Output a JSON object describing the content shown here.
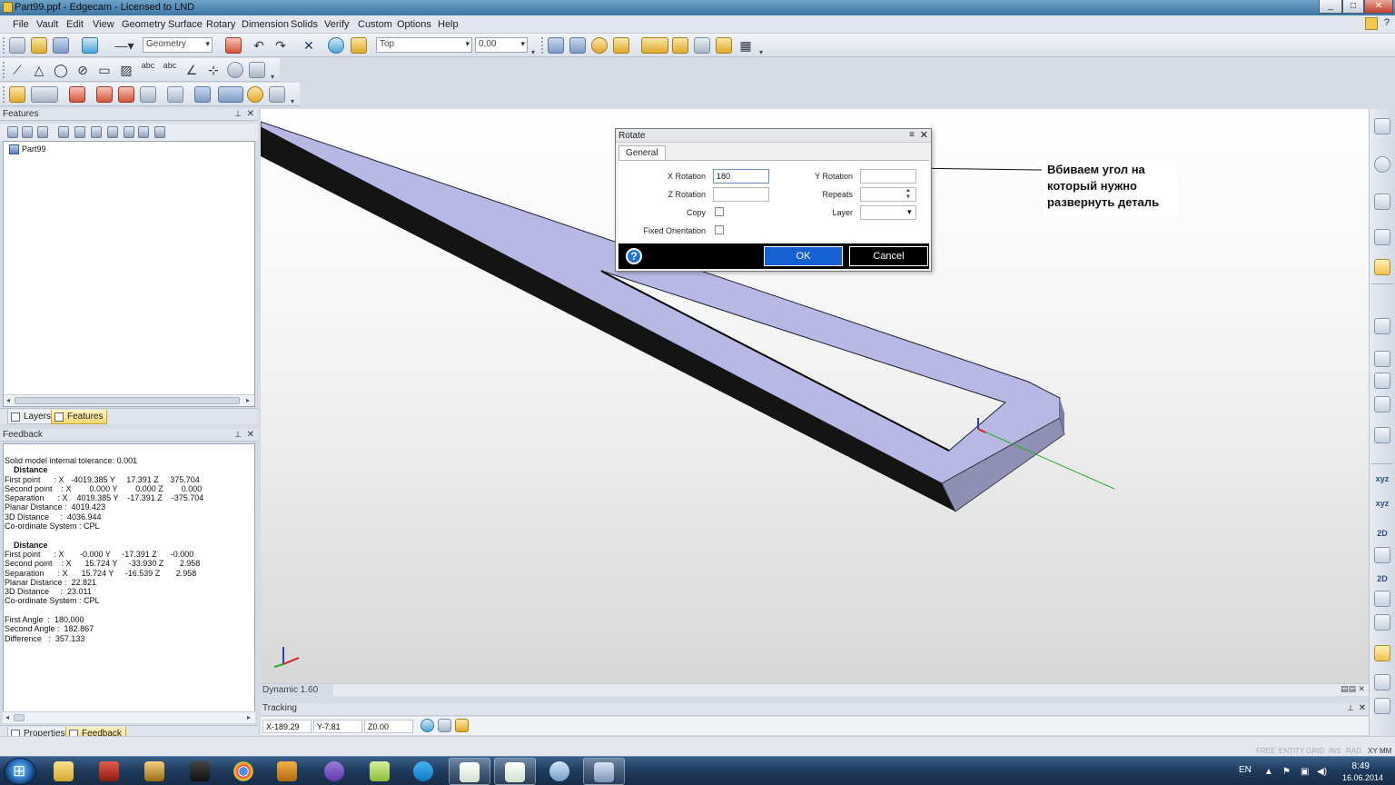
{
  "window": {
    "title": "Part99.ppf - Edgecam - Licensed to LND",
    "controls": [
      "_",
      "□",
      "✕"
    ]
  },
  "menu": {
    "items": [
      "File",
      "Vault",
      "Edit",
      "View",
      "Geometry",
      "Surface",
      "Rotary",
      "Dimension",
      "Solids",
      "Verify",
      "Custom",
      "Options",
      "Help"
    ]
  },
  "toolbar": {
    "mode_combo": "Geometry",
    "view_combo": "Top",
    "depth_combo": "0,00"
  },
  "features_panel": {
    "title": "Features",
    "tree_item": "Part99",
    "tabs": [
      "Layers",
      "Features"
    ],
    "active_tab": "Features"
  },
  "feedback_panel": {
    "title": "Feedback",
    "lines": [
      {
        "text": "Solid model internal tolerance: 0.001",
        "bold": false
      },
      {
        "text": "    Distance",
        "bold": true
      },
      {
        "text": "First point      : X   -4019.385 Y     17.391 Z     375.704",
        "bold": false
      },
      {
        "text": "Second point    : X        0.000 Y        0.000 Z        0.000",
        "bold": false
      },
      {
        "text": "Separation      : X    4019.385 Y    -17.391 Z    -375.704",
        "bold": false
      },
      {
        "text": "Planar Distance :  4019.423",
        "bold": false
      },
      {
        "text": "3D Distance     :  4036.944",
        "bold": false
      },
      {
        "text": "Co-ordinate System : CPL",
        "bold": false
      },
      {
        "text": "",
        "bold": false
      },
      {
        "text": "    Distance",
        "bold": true
      },
      {
        "text": "First point      : X       -0.000 Y     -17.391 Z      -0.000",
        "bold": false
      },
      {
        "text": "Second point    : X      15.724 Y     -33.930 Z       2.958",
        "bold": false
      },
      {
        "text": "Separation      : X      15.724 Y     -16.539 Z       2.958",
        "bold": false
      },
      {
        "text": "Planar Distance :  22.821",
        "bold": false
      },
      {
        "text": "3D Distance     :  23.011",
        "bold": false
      },
      {
        "text": "Co-ordinate System : CPL",
        "bold": false
      },
      {
        "text": "",
        "bold": false
      },
      {
        "text": "First Angle  :  180.000",
        "bold": false
      },
      {
        "text": "Second Angle :  182.867",
        "bold": false
      },
      {
        "text": "Difference   :  357.133",
        "bold": false
      }
    ],
    "tabs": [
      "Properties",
      "Feedback"
    ],
    "active_tab": "Feedback"
  },
  "viewport": {
    "dynamic_label": "Dynamic 1.60",
    "part_color": "#b7b8e3",
    "side_color": "#1a1a1a"
  },
  "tracking": {
    "title": "Tracking",
    "x": "X-189.29",
    "y": "Y-7.81",
    "z": "Z0.00"
  },
  "statusbar": {
    "flags": [
      "FREE",
      "ENTITY",
      "GRID",
      "INS",
      "RAD",
      "XY",
      "MM"
    ]
  },
  "rightbar": {
    "labels": [
      "xyz",
      "xyz",
      "2D",
      "2D"
    ]
  },
  "dialog": {
    "title": "Rotate",
    "tab": "General",
    "x_rotation_label": "X Rotation",
    "x_rotation_value": "180",
    "y_rotation_label": "Y Rotation",
    "y_rotation_value": "",
    "z_rotation_label": "Z Rotation",
    "z_rotation_value": "",
    "repeats_label": "Repeats",
    "repeats_value": "",
    "copy_label": "Copy",
    "layer_label": "Layer",
    "layer_value": "",
    "fixed_orientation_label": "Fixed Orientation",
    "ok_label": "OK",
    "cancel_label": "Cancel"
  },
  "annotation": {
    "text": "Вбиваем угол на который нужно развернуть деталь"
  },
  "taskbar": {
    "apps": [
      "explorer",
      "app-red",
      "pro-app",
      "3ds-app",
      "chrome",
      "media-player",
      "viber",
      "folder-app",
      "skype",
      "edgecam",
      "edgecam-2",
      "paint",
      "calculator"
    ],
    "language": "EN",
    "time": "8:49",
    "date": "16.06.2014"
  }
}
